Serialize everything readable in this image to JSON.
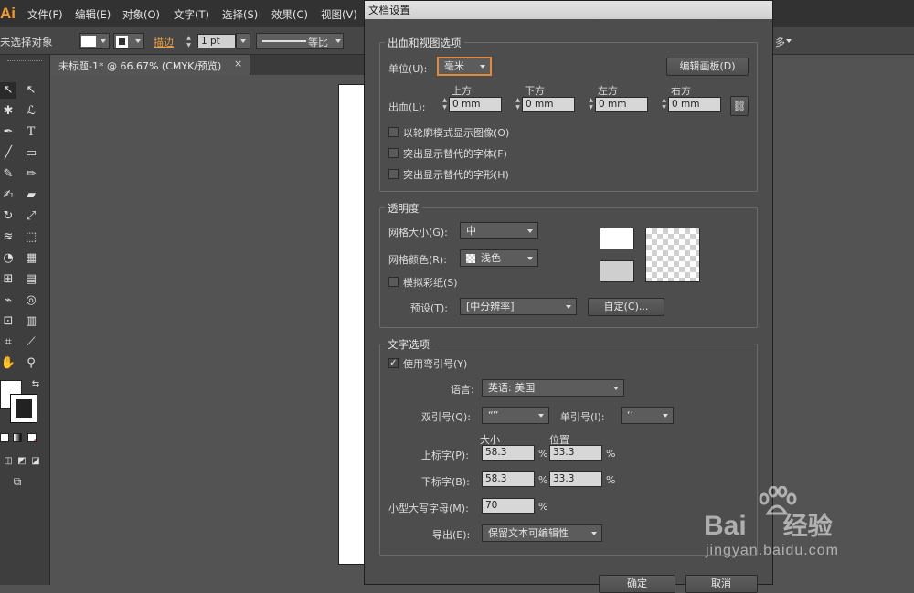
{
  "app": {
    "logo": "Ai"
  },
  "menubar": {
    "items": [
      "文件(F)",
      "编辑(E)",
      "对象(O)",
      "文字(T)",
      "选择(S)",
      "效果(C)",
      "视图(V)"
    ]
  },
  "controlbar": {
    "selection_status": "未选择对象",
    "stroke_label": "描边",
    "stroke_weight": "1 pt",
    "stroke_profile": "等比"
  },
  "document_tab": {
    "title": "未标题-1* @ 66.67% (CMYK/预览)",
    "close": "×"
  },
  "dialog": {
    "title": "文档设置",
    "bleed_view": {
      "group_title": "出血和视图选项",
      "unit_label": "单位(U):",
      "unit_value": "毫米",
      "edit_artboards_button": "编辑画板(D)",
      "bleed_label": "出血(L):",
      "top_label": "上方",
      "bottom_label": "下方",
      "left_label": "左方",
      "right_label": "右方",
      "top_value": "0 mm",
      "bottom_value": "0 mm",
      "left_value": "0 mm",
      "right_value": "0 mm",
      "outline_images": "以轮廓模式显示图像(O)",
      "highlight_fonts": "突出显示替代的字体(F)",
      "highlight_glyphs": "突出显示替代的字形(H)"
    },
    "transparency": {
      "group_title": "透明度",
      "grid_size_label": "网格大小(G):",
      "grid_size_value": "中",
      "grid_colors_label": "网格颜色(R):",
      "grid_colors_value": "浅色",
      "simulate_paper": "模拟彩纸(S)",
      "preset_label": "预设(T):",
      "preset_value": "[中分辨率]",
      "custom_button": "自定(C)..."
    },
    "type_options": {
      "group_title": "文字选项",
      "use_typographers_quotes": "使用弯引号(Y)",
      "use_typographers_quotes_checked": true,
      "language_label": "语言:",
      "language_value": "英语: 美国",
      "double_quotes_label": "双引号(Q):",
      "double_quotes_value": "“”",
      "single_quotes_label": "单引号(I):",
      "single_quotes_value": "‘’",
      "size_header": "大小",
      "position_header": "位置",
      "superscript_label": "上标字(P):",
      "superscript_size": "58.3",
      "superscript_position": "33.3",
      "subscript_label": "下标字(B):",
      "subscript_size": "58.3",
      "subscript_position": "33.3",
      "small_caps_label": "小型大写字母(M):",
      "small_caps_value": "70",
      "percent": "%",
      "export_label": "导出(E):",
      "export_value": "保留文本可编辑性"
    },
    "ok_button": "确定",
    "cancel_button": "取消"
  },
  "watermark": {
    "brand": "Bai",
    "brand2": "经验",
    "url": "jingyan.baidu.com"
  },
  "colors": {
    "accent": "#f59a23",
    "panel": "#4d4d4d",
    "focus": "#e08a3c"
  }
}
